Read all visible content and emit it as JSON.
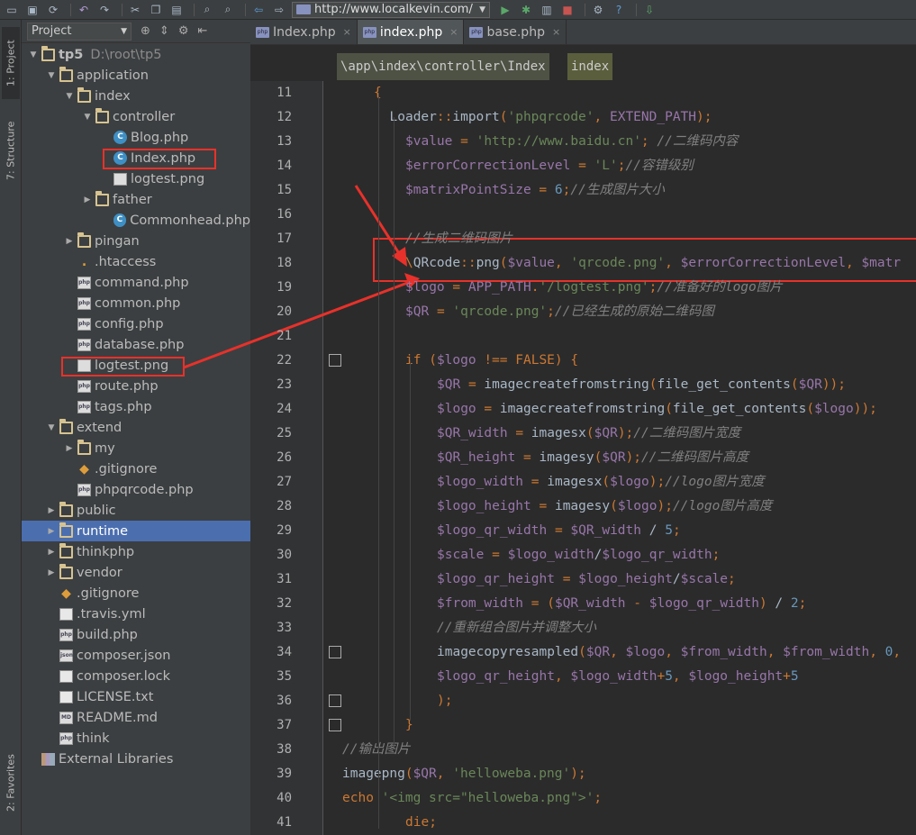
{
  "toolbar": {
    "url": "http://www.localkevin.com/",
    "icons": [
      "open-icon",
      "save-icon",
      "sync-icon",
      "undo-icon",
      "redo-icon",
      "cut-icon",
      "copy-icon",
      "paste-icon",
      "find-icon",
      "replace-icon",
      "back-icon",
      "forward-icon",
      "run-icon",
      "debug-icon",
      "coverage-icon",
      "stop-icon",
      "settings-icon",
      "help-icon",
      "update-icon"
    ]
  },
  "sidebar_tabs": {
    "project": "1: Project",
    "structure": "7: Structure",
    "favorites": "2: Favorites"
  },
  "panel": {
    "dropdown": "Project"
  },
  "tree": [
    {
      "label": "tp5",
      "extra": "D:\\root\\tp5",
      "depth": 0,
      "type": "folder",
      "open": true
    },
    {
      "label": "application",
      "depth": 1,
      "type": "folder",
      "open": true
    },
    {
      "label": "index",
      "depth": 2,
      "type": "folder",
      "open": true
    },
    {
      "label": "controller",
      "depth": 3,
      "type": "folder",
      "open": true
    },
    {
      "label": "Blog.php",
      "depth": 4,
      "type": "class"
    },
    {
      "label": "Index.php",
      "depth": 4,
      "type": "class",
      "highlight": true
    },
    {
      "label": "logtest.png",
      "depth": 4,
      "type": "image"
    },
    {
      "label": "father",
      "depth": 3,
      "type": "folder",
      "open": false
    },
    {
      "label": "Commonhead.php",
      "depth": 4,
      "type": "class"
    },
    {
      "label": "pingan",
      "depth": 2,
      "type": "folder",
      "open": false
    },
    {
      "label": ".htaccess",
      "depth": 2,
      "type": "hta"
    },
    {
      "label": "command.php",
      "depth": 2,
      "type": "php"
    },
    {
      "label": "common.php",
      "depth": 2,
      "type": "php"
    },
    {
      "label": "config.php",
      "depth": 2,
      "type": "php"
    },
    {
      "label": "database.php",
      "depth": 2,
      "type": "php"
    },
    {
      "label": "logtest.png",
      "depth": 2,
      "type": "image",
      "highlight": true
    },
    {
      "label": "route.php",
      "depth": 2,
      "type": "php"
    },
    {
      "label": "tags.php",
      "depth": 2,
      "type": "php"
    },
    {
      "label": "extend",
      "depth": 1,
      "type": "folder",
      "open": true
    },
    {
      "label": "my",
      "depth": 2,
      "type": "folder",
      "open": false
    },
    {
      "label": ".gitignore",
      "depth": 2,
      "type": "git"
    },
    {
      "label": "phpqrcode.php",
      "depth": 2,
      "type": "php"
    },
    {
      "label": "public",
      "depth": 1,
      "type": "folder",
      "open": false
    },
    {
      "label": "runtime",
      "depth": 1,
      "type": "folder",
      "open": false,
      "selected": true
    },
    {
      "label": "thinkphp",
      "depth": 1,
      "type": "folder",
      "open": false
    },
    {
      "label": "vendor",
      "depth": 1,
      "type": "folder",
      "open": false
    },
    {
      "label": ".gitignore",
      "depth": 1,
      "type": "git"
    },
    {
      "label": ".travis.yml",
      "depth": 1,
      "type": "text"
    },
    {
      "label": "build.php",
      "depth": 1,
      "type": "php"
    },
    {
      "label": "composer.json",
      "depth": 1,
      "type": "json"
    },
    {
      "label": "composer.lock",
      "depth": 1,
      "type": "text"
    },
    {
      "label": "LICENSE.txt",
      "depth": 1,
      "type": "text"
    },
    {
      "label": "README.md",
      "depth": 1,
      "type": "md"
    },
    {
      "label": "think",
      "depth": 1,
      "type": "php"
    },
    {
      "label": "External Libraries",
      "depth": 0,
      "type": "lib"
    }
  ],
  "tabs": [
    {
      "label": "Index.php",
      "active": false
    },
    {
      "label": "index.php",
      "active": true
    },
    {
      "label": "base.php",
      "active": false
    }
  ],
  "breadcrumb": {
    "path": "\\app\\index\\controller\\Index",
    "method": "index"
  },
  "code": [
    {
      "n": "11",
      "t": "{"
    },
    {
      "n": "12",
      "t": "Loader::import('phpqrcode', EXTEND_PATH);"
    },
    {
      "n": "13",
      "t": "$value = 'http://www.baidu.cn'; //二维码内容"
    },
    {
      "n": "14",
      "t": "$errorCorrectionLevel = 'L';//容错级别"
    },
    {
      "n": "15",
      "t": "$matrixPointSize = 6;//生成图片大小"
    },
    {
      "n": "16",
      "t": ""
    },
    {
      "n": "17",
      "t": "//生成二维码图片"
    },
    {
      "n": "18",
      "t": "\\QRcode::png($value, 'qrcode.png', $errorCorrectionLevel, $matr"
    },
    {
      "n": "19",
      "t": "$logo = APP_PATH.'/logtest.png';//准备好的logo图片"
    },
    {
      "n": "20",
      "t": "$QR = 'qrcode.png';//已经生成的原始二维码图"
    },
    {
      "n": "21",
      "t": ""
    },
    {
      "n": "22",
      "t": "if ($logo !== FALSE) {"
    },
    {
      "n": "23",
      "t": "$QR = imagecreatefromstring(file_get_contents($QR));"
    },
    {
      "n": "24",
      "t": "$logo = imagecreatefromstring(file_get_contents($logo));"
    },
    {
      "n": "25",
      "t": "$QR_width = imagesx($QR);//二维码图片宽度"
    },
    {
      "n": "26",
      "t": "$QR_height = imagesy($QR);//二维码图片高度"
    },
    {
      "n": "27",
      "t": "$logo_width = imagesx($logo);//logo图片宽度"
    },
    {
      "n": "28",
      "t": "$logo_height = imagesy($logo);//logo图片高度"
    },
    {
      "n": "29",
      "t": "$logo_qr_width = $QR_width / 5;"
    },
    {
      "n": "30",
      "t": "$scale = $logo_width/$logo_qr_width;"
    },
    {
      "n": "31",
      "t": "$logo_qr_height = $logo_height/$scale;"
    },
    {
      "n": "32",
      "t": "$from_width = ($QR_width - $logo_qr_width) / 2;"
    },
    {
      "n": "33",
      "t": "//重新组合图片并调整大小"
    },
    {
      "n": "34",
      "t": "imagecopyresampled($QR, $logo, $from_width, $from_width, 0,"
    },
    {
      "n": "35",
      "t": "$logo_qr_height, $logo_width+5, $logo_height+5"
    },
    {
      "n": "36",
      "t": ");"
    },
    {
      "n": "37",
      "t": "}"
    },
    {
      "n": "38",
      "t": "//输出图片"
    },
    {
      "n": "39",
      "t": "imagepng($QR, 'helloweba.png');"
    },
    {
      "n": "40",
      "t": "echo '<img src=\"helloweba.png\">';"
    },
    {
      "n": "41",
      "t": "die;"
    }
  ]
}
